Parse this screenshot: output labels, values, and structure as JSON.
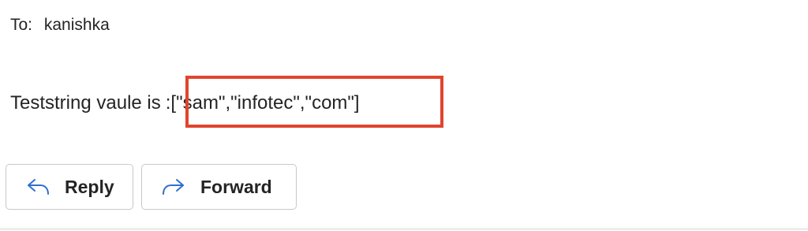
{
  "header": {
    "to_label": "To:",
    "recipient": "kanishka"
  },
  "message": {
    "prefix": "Teststring vaule is",
    "separator": ":",
    "value": "[\"sam\",\"infotec\",\"com\"]",
    "highlight_color": "#e0452e"
  },
  "actions": {
    "reply_label": "Reply",
    "reply_icon": "reply-arrow-icon",
    "forward_label": "Forward",
    "forward_icon": "forward-arrow-icon",
    "icon_color": "#2f6fd1"
  }
}
